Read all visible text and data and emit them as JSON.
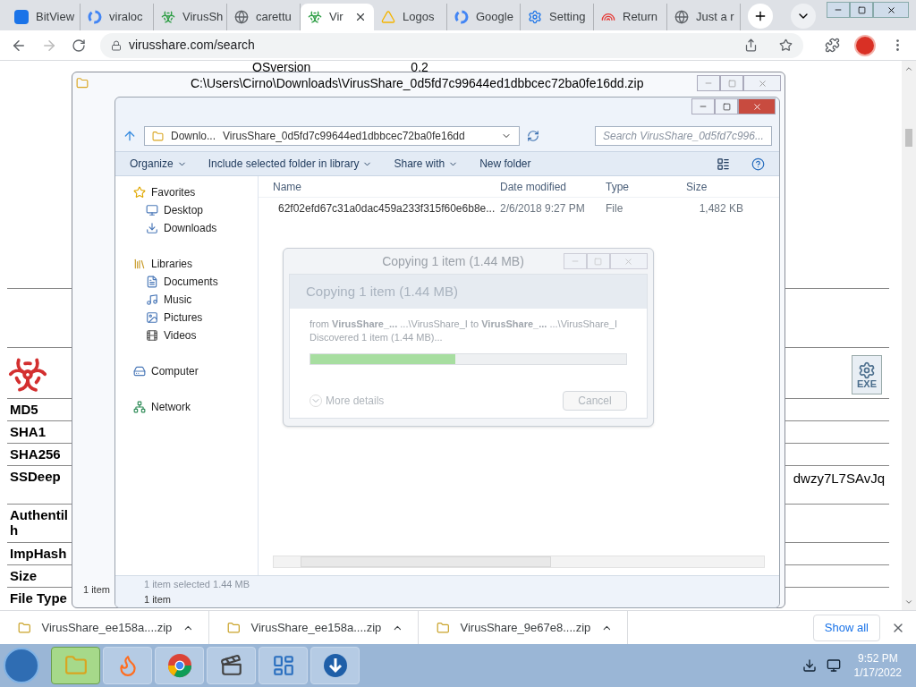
{
  "browser": {
    "tabs": [
      {
        "title": "BitView",
        "kind": "bitview",
        "selected": false
      },
      {
        "title": "viraloc",
        "kind": "google",
        "selected": false
      },
      {
        "title": "VirusSh",
        "kind": "biohazard",
        "selected": false
      },
      {
        "title": "carettu",
        "kind": "globe",
        "selected": false
      },
      {
        "title": "Vir",
        "kind": "biohazard",
        "selected": true
      },
      {
        "title": "Logos",
        "kind": "drive",
        "selected": false
      },
      {
        "title": "Google",
        "kind": "google",
        "selected": false
      },
      {
        "title": "Setting",
        "kind": "gear",
        "selected": false
      },
      {
        "title": "Return",
        "kind": "rainbow",
        "selected": false
      },
      {
        "title": "Just a r",
        "kind": "globe",
        "selected": false
      }
    ],
    "url": "virusshare.com/search"
  },
  "page": {
    "top_row": [
      "OSversion",
      "0.2"
    ],
    "file_icon_label": "EXE",
    "rows": [
      {
        "label": "MD5"
      },
      {
        "label": "SHA1"
      },
      {
        "label": "SHA256"
      },
      {
        "label": "SSDeep",
        "value": "dwzy7L7SAvJq"
      },
      {
        "label": "Authentil h"
      },
      {
        "label": "ImpHash"
      },
      {
        "label": "Size"
      },
      {
        "label": "File Type"
      }
    ]
  },
  "explorer_back": {
    "title": "C:\\Users\\Cirno\\Downloads\\VirusShare_0d5fd7c99644ed1dbbcec72ba0fe16dd.zip",
    "status": "1 item"
  },
  "explorer": {
    "breadcrumb": [
      "Downlo...",
      "VirusShare_0d5fd7c99644ed1dbbcec72ba0fe16dd"
    ],
    "search_placeholder": "Search VirusShare_0d5fd7c996...",
    "toolbar": [
      {
        "label": "Organize",
        "dropdown": true
      },
      {
        "label": "Include selected folder in library",
        "dropdown": true
      },
      {
        "label": "Share with",
        "dropdown": true
      },
      {
        "label": "New folder",
        "dropdown": false
      }
    ],
    "nav": [
      {
        "label": "Favorites",
        "kind": "star",
        "children": [
          {
            "label": "Desktop",
            "kind": "desktop"
          },
          {
            "label": "Downloads",
            "kind": "downloads"
          }
        ]
      },
      {
        "label": "Libraries",
        "kind": "library",
        "children": [
          {
            "label": "Documents",
            "kind": "documents"
          },
          {
            "label": "Music",
            "kind": "music"
          },
          {
            "label": "Pictures",
            "kind": "pictures"
          },
          {
            "label": "Videos",
            "kind": "videos"
          }
        ]
      },
      {
        "label": "Computer",
        "kind": "computer"
      },
      {
        "label": "Network",
        "kind": "network"
      }
    ],
    "columns": [
      "Name",
      "Date modified",
      "Type",
      "Size"
    ],
    "files": [
      {
        "name": "62f02efd67c31a0dac459a233f315f60e6b8e...",
        "date": "2/6/2018 9:27 PM",
        "type": "File",
        "size": "1,482 KB"
      }
    ],
    "status": [
      "1 item selected 1.44 MB",
      "1 item"
    ]
  },
  "copy_dialog": {
    "title": "Copying 1 item (1.44 MB)",
    "heading": "Copying 1 item (1.44 MB)",
    "from": "from **VirusShare_...** ...\\VirusShare_I to **VirusShare_...** ...\\VirusShare_I",
    "discovered": "Discovered 1 item (1.44 MB)...",
    "level": 0.46,
    "more_details": "More details",
    "cancel": "Cancel"
  },
  "downloads": {
    "items": [
      "VirusShare_ee158a....zip",
      "VirusShare_ee158a....zip",
      "VirusShare_9e67e8....zip"
    ],
    "show_all": "Show all"
  },
  "taskbar": {
    "apps": [
      {
        "kind": "explorer",
        "active": true
      },
      {
        "kind": "firefox",
        "active": false
      },
      {
        "kind": "chrome",
        "active": false
      },
      {
        "kind": "media",
        "active": false
      },
      {
        "kind": "control-panel",
        "active": false
      },
      {
        "kind": "downloader",
        "active": false
      }
    ],
    "time": "9:52 PM",
    "date": "1/17/2022"
  }
}
